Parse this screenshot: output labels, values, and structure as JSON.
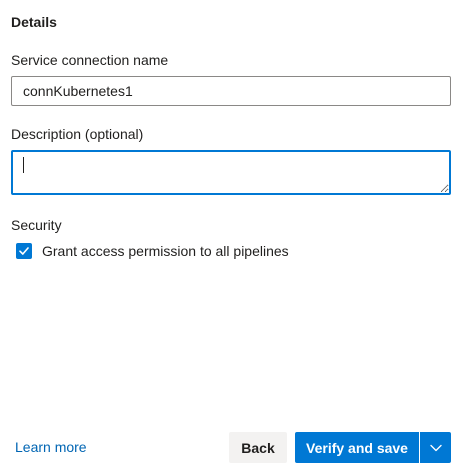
{
  "section_title": "Details",
  "service_connection": {
    "label": "Service connection name",
    "value": "connKubernetes1"
  },
  "description": {
    "label": "Description (optional)",
    "value": ""
  },
  "security": {
    "label": "Security",
    "checkbox_label": "Grant access permission to all pipelines",
    "checked": true
  },
  "footer": {
    "learn_more": "Learn more",
    "back_label": "Back",
    "primary_label": "Verify and save"
  },
  "colors": {
    "accent": "#0078d4",
    "link": "#0065b3",
    "secondary_button": "#f3f2f1"
  },
  "icons": {
    "checkbox": "checkmark-icon",
    "split_button": "chevron-down-icon"
  }
}
